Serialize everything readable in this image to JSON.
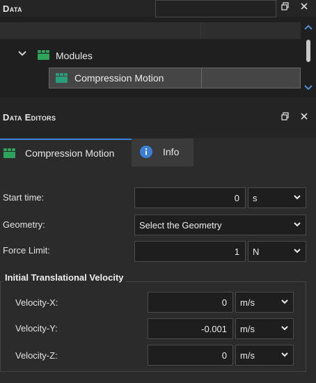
{
  "data_panel": {
    "title": "Data",
    "tree": {
      "modules_label": "Modules",
      "selected_item_label": "Compression Motion"
    }
  },
  "editors_panel": {
    "title": "Data Editors",
    "tabs": [
      {
        "label": "Compression Motion",
        "icon": "block-icon"
      },
      {
        "label": "Info",
        "icon": "info-icon"
      }
    ]
  },
  "form": {
    "start_time": {
      "label": "Start time:",
      "value": "0",
      "unit": "s"
    },
    "geometry": {
      "label": "Geometry:",
      "value": "Select the Geometry"
    },
    "force_limit": {
      "label": "Force Limit:",
      "value": "1",
      "unit": "N"
    },
    "velocity_group": {
      "title": "Initial Translational Velocity",
      "x": {
        "label": "Velocity-X:",
        "value": "0",
        "unit": "m/s"
      },
      "y": {
        "label": "Velocity-Y:",
        "value": "-0.001",
        "unit": "m/s"
      },
      "z": {
        "label": "Velocity-Z:",
        "value": "0",
        "unit": "m/s"
      }
    }
  },
  "colors": {
    "accent": "#3a7fd5",
    "module_green": "#2ea35b",
    "info_blue": "#3a7fd5"
  }
}
